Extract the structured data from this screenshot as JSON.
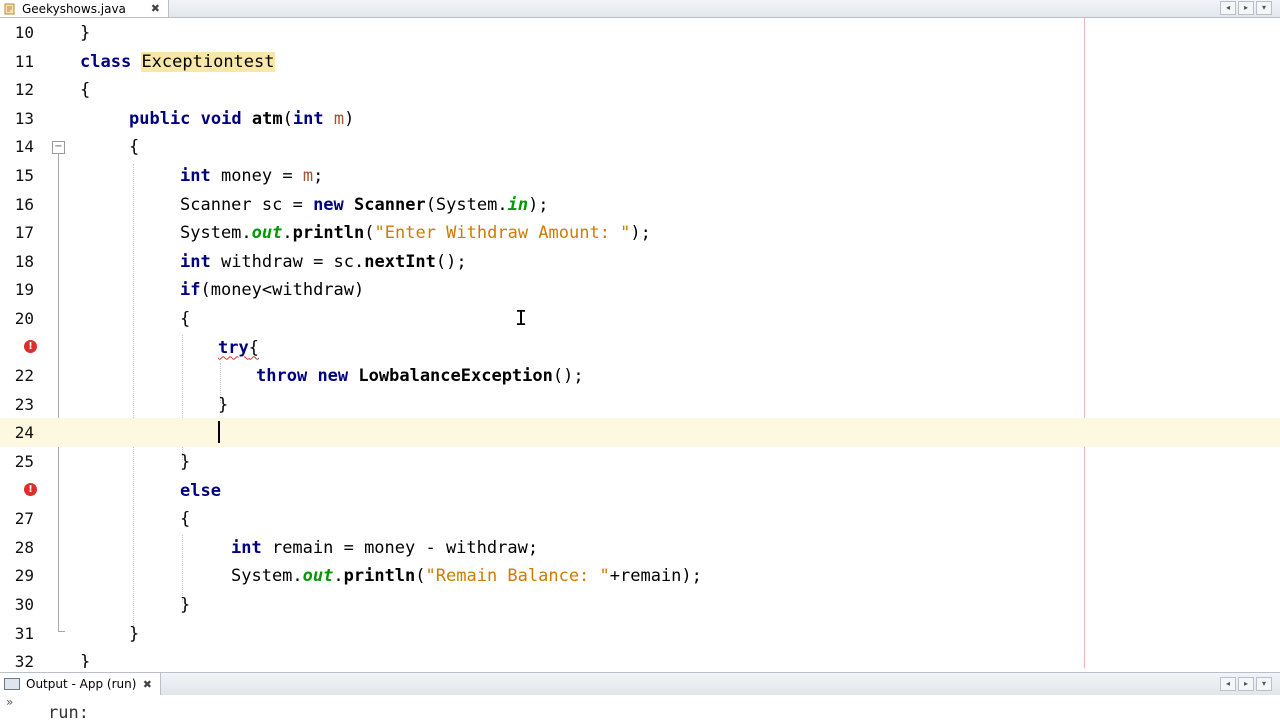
{
  "editor_tab": {
    "title": "Geekyshows.java",
    "close": "✖",
    "icon": "java-file-icon"
  },
  "tab_scroll": {
    "left": "◂",
    "right": "▸",
    "menu": "▾"
  },
  "lines": [
    {
      "n": "10",
      "code": "}"
    },
    {
      "n": "11",
      "code": "class Exceptiontest"
    },
    {
      "n": "12",
      "code": "{"
    },
    {
      "n": "13",
      "code": "public void atm(int m)"
    },
    {
      "n": "14",
      "code": "{"
    },
    {
      "n": "15",
      "code": "int money = m;"
    },
    {
      "n": "16",
      "code": "Scanner sc = new Scanner(System.in);"
    },
    {
      "n": "17",
      "code": "System.out.println(\"Enter Withdraw Amount: \");"
    },
    {
      "n": "18",
      "code": "int withdraw = sc.nextInt();"
    },
    {
      "n": "19",
      "code": "if(money<withdraw)"
    },
    {
      "n": "20",
      "code": "{"
    },
    {
      "n": "",
      "code": "try{",
      "error": true
    },
    {
      "n": "22",
      "code": "throw new LowbalanceException();"
    },
    {
      "n": "23",
      "code": "}"
    },
    {
      "n": "24",
      "code": "",
      "current": true
    },
    {
      "n": "25",
      "code": "}"
    },
    {
      "n": "",
      "code": "else",
      "error": true
    },
    {
      "n": "27",
      "code": "{"
    },
    {
      "n": "28",
      "code": "int remain = money - withdraw;"
    },
    {
      "n": "29",
      "code": "System.out.println(\"Remain Balance: \"+remain);"
    },
    {
      "n": "30",
      "code": "}"
    },
    {
      "n": "31",
      "code": "}"
    },
    {
      "n": "32",
      "code": "}"
    }
  ],
  "tokens": {
    "l10": [
      "}"
    ],
    "l11": [
      "class",
      " ",
      "Exceptiontest"
    ],
    "l12": [
      "{"
    ],
    "l13": [
      "public",
      " ",
      "void",
      " ",
      "atm",
      "(",
      "int",
      " ",
      "m",
      ")"
    ],
    "l14": [
      "{"
    ],
    "l15": [
      "int",
      " money = ",
      "m",
      ";"
    ],
    "l16": [
      "Scanner sc = ",
      "new",
      " ",
      "Scanner",
      "(System.",
      "in",
      ");"
    ],
    "l17": [
      "System.",
      "out",
      ".",
      "println",
      "(",
      "\"Enter Withdraw Amount: \"",
      ");"
    ],
    "l18": [
      "int",
      " withdraw = sc.",
      "nextInt",
      "();"
    ],
    "l19": [
      "if",
      "(money<withdraw)"
    ],
    "l20": [
      "{"
    ],
    "l21": [
      "try",
      "{"
    ],
    "l22": [
      "throw",
      " ",
      "new",
      " ",
      "LowbalanceException",
      "();"
    ],
    "l23": [
      "}"
    ],
    "l25": [
      "}"
    ],
    "l26": [
      "else"
    ],
    "l27": [
      "{"
    ],
    "l28": [
      "int",
      " remain = money - withdraw;"
    ],
    "l29": [
      "System.",
      "out",
      ".",
      "println",
      "(",
      "\"Remain Balance: \"",
      "+remain);"
    ],
    "l30": [
      "}"
    ],
    "l31": [
      "}"
    ],
    "l32": [
      "}"
    ]
  },
  "error_glyph": "!",
  "fold_toggle": "−",
  "output_tab": {
    "title": "Output - App (run)",
    "close": "✖",
    "icon": "output-window-icon"
  },
  "output": {
    "arrows": "»",
    "text": "run:"
  },
  "mouse_cursor": "I"
}
